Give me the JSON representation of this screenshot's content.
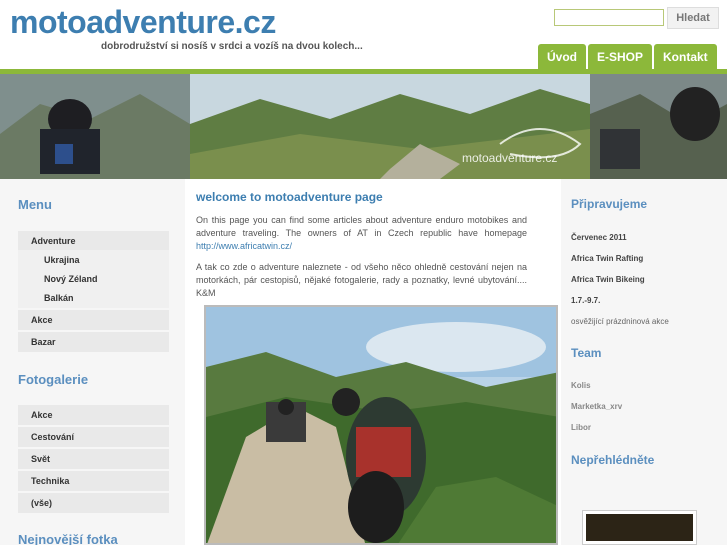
{
  "header": {
    "logo": "motoadventure.cz",
    "tagline": "dobrodružství si nosíš v srdci a vozíš na dvou kolech...",
    "search_button": "Hledat",
    "search_value": ""
  },
  "nav": [
    "Úvod",
    "E-SHOP",
    "Kontakt"
  ],
  "banner": {
    "watermark": "motoadventure.cz"
  },
  "left": {
    "menu_title": "Menu",
    "menu": [
      "Adventure",
      "Ukrajina",
      "Nový Zéland",
      "Balkán",
      "Akce",
      "Bazar"
    ],
    "gallery_title": "Fotogalerie",
    "gallery": [
      "Akce",
      "Cestování",
      "Svět",
      "Technika",
      "(vše)"
    ],
    "newest_title": "Nejnovější fotka"
  },
  "main": {
    "title": "welcome to motoadventure page",
    "p1": "On this page you can find some articles about adventure enduro motobikes and adventure traveling. The owners of AT in Czech republic have homepage",
    "p1_link": "http://www.africatwin.cz/",
    "p2": "A tak co zde o adventure naleznete - od všeho něco ohledně cestování nejen na motorkách, pár cestopisů, nějaké fotogalerie, rady a poznatky, levné ubytování.... K&M"
  },
  "right": {
    "upcoming_title": "Připravujeme",
    "upcoming": [
      "Červenec 2011",
      "Africa Twin Rafting",
      "Africa Twin Bikeing",
      "1.7.-9.7.",
      "osvěžijící prázdninová akce"
    ],
    "team_title": "Team",
    "team": [
      "Kolis",
      "Marketka_xrv",
      "Libor"
    ],
    "dontmiss_title": "Nepřehlédněte"
  },
  "colors": {
    "accent": "#8cb83a",
    "brand": "#3d7eb0"
  }
}
